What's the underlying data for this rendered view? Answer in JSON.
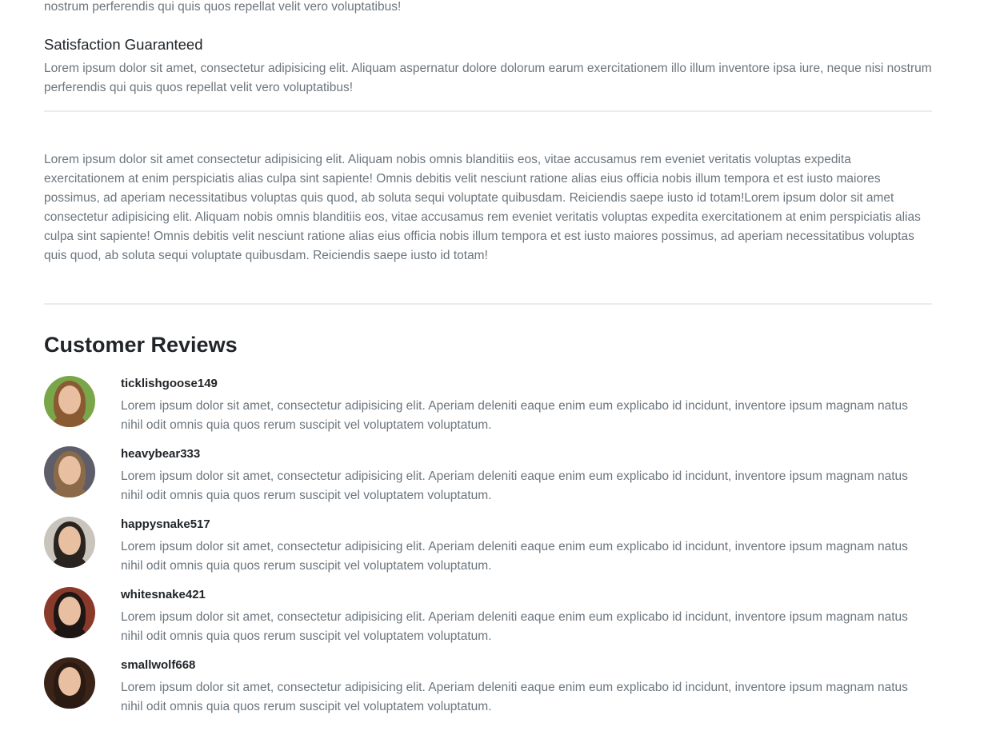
{
  "top_text": "nostrum perferendis qui quis quos repellat velit vero voluptatibus!",
  "feature": {
    "title": "Satisfaction Guaranteed",
    "text": "Lorem ipsum dolor sit amet, consectetur adipisicing elit. Aliquam aspernatur dolore dolorum earum exercitationem illo illum inventore ipsa iure, neque nisi nostrum perferendis qui quis quos repellat velit vero voluptatibus!"
  },
  "description": "Lorem ipsum dolor sit amet consectetur adipisicing elit. Aliquam nobis omnis blanditiis eos, vitae accusamus rem eveniet veritatis voluptas expedita exercitationem at enim perspiciatis alias culpa sint sapiente! Omnis debitis velit nesciunt ratione alias eius officia nobis illum tempora et est iusto maiores possimus, ad aperiam necessitatibus voluptas quis quod, ab soluta sequi voluptate quibusdam. Reiciendis saepe iusto id totam!Lorem ipsum dolor sit amet consectetur adipisicing elit. Aliquam nobis omnis blanditiis eos, vitae accusamus rem eveniet veritatis voluptas expedita exercitationem at enim perspiciatis alias culpa sint sapiente! Omnis debitis velit nesciunt ratione alias eius officia nobis illum tempora et est iusto maiores possimus, ad aperiam necessitatibus voluptas quis quod, ab soluta sequi voluptate quibusdam. Reiciendis saepe iusto id totam!",
  "reviews_title": "Customer Reviews",
  "reviews": [
    {
      "user": "ticklishgoose149",
      "text": "Lorem ipsum dolor sit amet, consectetur adipisicing elit. Aperiam deleniti eaque enim eum explicabo id incidunt, inventore ipsum magnam natus nihil odit omnis quia quos rerum suscipit vel voluptatem voluptatum.",
      "bg": "#7aa64a",
      "hair": "#8a5a32"
    },
    {
      "user": "heavybear333",
      "text": "Lorem ipsum dolor sit amet, consectetur adipisicing elit. Aperiam deleniti eaque enim eum explicabo id incidunt, inventore ipsum magnam natus nihil odit omnis quia quos rerum suscipit vel voluptatem voluptatum.",
      "bg": "#5e5e6a",
      "hair": "#8a6a48"
    },
    {
      "user": "happysnake517",
      "text": "Lorem ipsum dolor sit amet, consectetur adipisicing elit. Aperiam deleniti eaque enim eum explicabo id incidunt, inventore ipsum magnam natus nihil odit omnis quia quos rerum suscipit vel voluptatem voluptatum.",
      "bg": "#c9c4bc",
      "hair": "#2a2420"
    },
    {
      "user": "whitesnake421",
      "text": "Lorem ipsum dolor sit amet, consectetur adipisicing elit. Aperiam deleniti eaque enim eum explicabo id incidunt, inventore ipsum magnam natus nihil odit omnis quia quos rerum suscipit vel voluptatem voluptatum.",
      "bg": "#8a3a2a",
      "hair": "#1e1614"
    },
    {
      "user": "smallwolf668",
      "text": "Lorem ipsum dolor sit amet, consectetur adipisicing elit. Aperiam deleniti eaque enim eum explicabo id incidunt, inventore ipsum magnam natus nihil odit omnis quia quos rerum suscipit vel voluptatem voluptatum.",
      "bg": "#3a2418",
      "hair": "#2a1a12"
    }
  ]
}
